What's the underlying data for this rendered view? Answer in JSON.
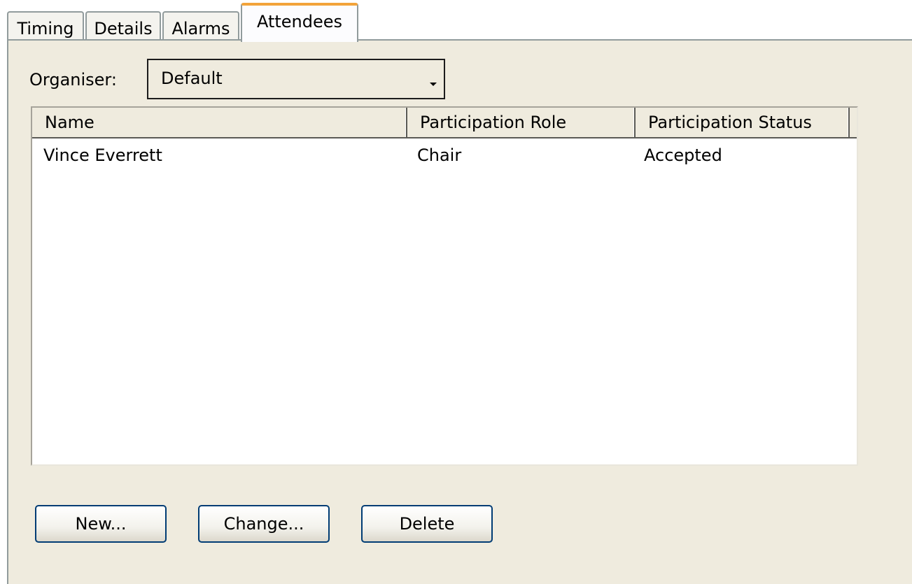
{
  "tabs": [
    {
      "label": "Timing",
      "active": false
    },
    {
      "label": "Details",
      "active": false
    },
    {
      "label": "Alarms",
      "active": false
    },
    {
      "label": "Attendees",
      "active": true
    }
  ],
  "organiser": {
    "label": "Organiser:",
    "value": "Default"
  },
  "attendees_table": {
    "columns": [
      "Name",
      "Participation Role",
      "Participation Status"
    ],
    "rows": [
      {
        "name": "Vince Everrett",
        "role": "Chair",
        "status": "Accepted"
      }
    ]
  },
  "buttons": {
    "new": "New...",
    "change": "Change...",
    "delete": "Delete"
  },
  "colors": {
    "panel_background": "#efebde",
    "active_tab_accent": "#f2a33a",
    "button_border": "#003c74"
  }
}
